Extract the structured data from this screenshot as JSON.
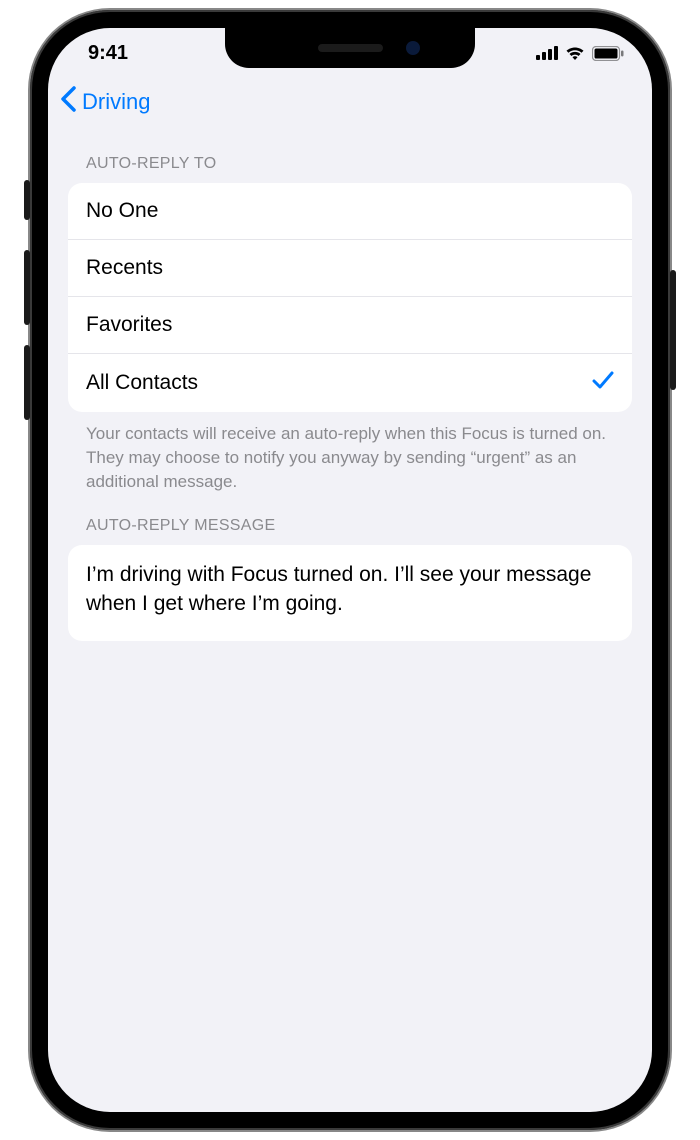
{
  "status": {
    "time": "9:41"
  },
  "nav": {
    "back_label": "Driving"
  },
  "sections": {
    "auto_reply_to": {
      "header": "AUTO-REPLY TO",
      "options": [
        {
          "label": "No One",
          "selected": false
        },
        {
          "label": "Recents",
          "selected": false
        },
        {
          "label": "Favorites",
          "selected": false
        },
        {
          "label": "All Contacts",
          "selected": true
        }
      ],
      "footer": "Your contacts will receive an auto-reply when this Focus is turned on. They may choose to notify you anyway by sending “urgent” as an additional message."
    },
    "auto_reply_message": {
      "header": "AUTO-REPLY MESSAGE",
      "text": "I’m driving with Focus turned on. I’ll see your message when I get where I’m going."
    }
  }
}
